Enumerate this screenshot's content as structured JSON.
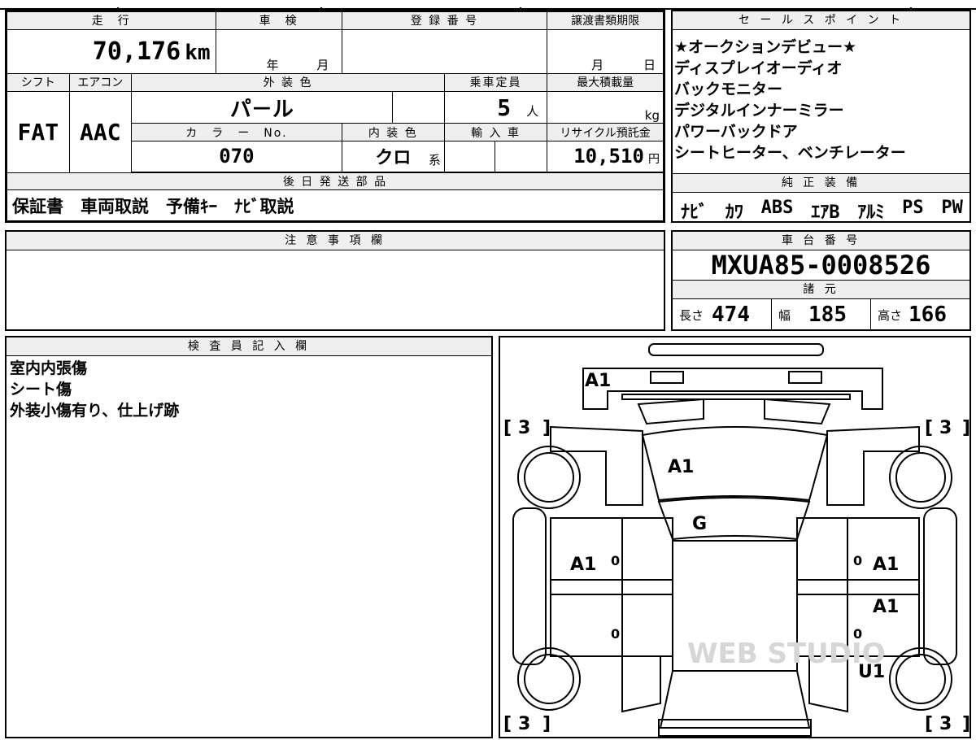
{
  "headers": {
    "mileage": "走　行",
    "shaken": "車　検",
    "registration": "登 録 番 号",
    "transfer_deadline": "譲渡書類期限",
    "shift": "シフト",
    "aircon": "エアコン",
    "exterior_color": "外 装 色",
    "capacity": "乗車定員",
    "max_load": "最大積載量",
    "color_no": "カ　ラ　ー　No.",
    "interior_color": "内 装 色",
    "import": "輸 入 車",
    "recycle": "リサイクル預託金",
    "later_parts": "後 日 発 送 部 品",
    "sales_points": "セ ー ル ス ポ イ ン ト",
    "genuine_equipment": "純 正 装 備",
    "notes": "注 意 事 項 欄",
    "chassis_number": "車 台 番 号",
    "specs": "諸 元",
    "inspector_notes": "検 査 員 記 入 欄"
  },
  "mileage": {
    "value": "70,176",
    "unit": "km"
  },
  "shaken": {
    "year_label": "年",
    "month_label": "月"
  },
  "transfer": {
    "month_label": "月",
    "day_label": "日"
  },
  "shift": "FAT",
  "aircon": "AAC",
  "exterior_color": "パ－ル",
  "capacity": {
    "value": "5",
    "unit": "人"
  },
  "max_load": {
    "unit": "kg"
  },
  "color_no": "070",
  "interior_color": {
    "value": "クロ",
    "suffix": "系"
  },
  "recycle": {
    "value": "10,510",
    "unit": "円"
  },
  "later_parts": "保証書　車両取説　予備ｷｰ　ﾅﾋﾞ取説",
  "sales_points": [
    "★オークションデビュー★",
    "ディスプレイオーディオ",
    "バックモニター",
    "デジタルインナーミラー",
    "パワーバックドア",
    "シートヒーター、ベンチレーター"
  ],
  "genuine_equipment": [
    "ﾅﾋﾞ",
    "ｶﾜ",
    "ABS",
    "ｴｱB",
    "ｱﾙﾐ",
    "PS",
    "PW"
  ],
  "chassis_number": "MXUA85-0008526",
  "specs": {
    "length_label": "長さ",
    "length": "474",
    "width_label": "幅",
    "width": "185",
    "height_label": "高さ",
    "height": "166"
  },
  "inspector_notes": [
    "室内内張傷",
    "シート傷",
    "外装小傷有り、仕上げ跡"
  ],
  "diagram_marks": {
    "front_bumper": "A1",
    "hood": "A1",
    "windshield": "G",
    "left_front_door": "A1",
    "right_front_door": "A1",
    "right_rear_door": "A1",
    "right_rear_fender": "U1",
    "tire_tread": "3",
    "zero_marks": "0"
  },
  "watermark": "WEB STUDIO"
}
